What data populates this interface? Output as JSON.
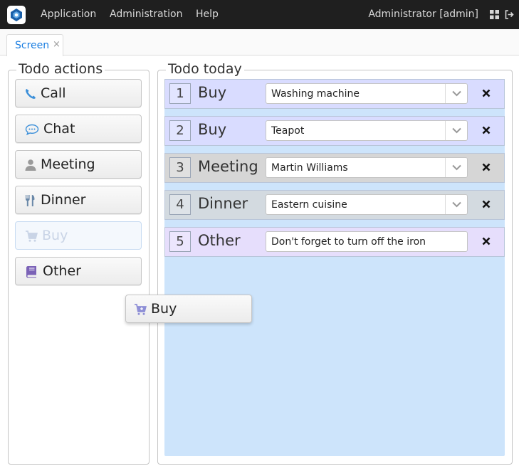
{
  "menubar": {
    "items": [
      "Application",
      "Administration",
      "Help"
    ],
    "user": "Administrator [admin]"
  },
  "tabs": [
    {
      "label": "Screen",
      "close": "×"
    }
  ],
  "todo_actions": {
    "title": "Todo actions",
    "buttons": [
      {
        "label": "Call",
        "icon": "phone-icon",
        "color": "#3b8fd9"
      },
      {
        "label": "Chat",
        "icon": "chat-bubble-icon",
        "color": "#3b8fd9"
      },
      {
        "label": "Meeting",
        "icon": "user-icon",
        "color": "#9a9a9a"
      },
      {
        "label": "Dinner",
        "icon": "cutlery-icon",
        "color": "#6a88a8"
      },
      {
        "label": "Buy",
        "icon": "cart-icon",
        "color": "#c9d4e6",
        "disabled": true
      },
      {
        "label": "Other",
        "icon": "book-icon",
        "color": "#7b62b7"
      }
    ]
  },
  "drag_ghost": {
    "label": "Buy",
    "icon": "cart-icon",
    "color": "#8e8fd6"
  },
  "todo_today": {
    "title": "Todo today",
    "rows": [
      {
        "num": "1",
        "type": "Buy",
        "value": "Washing machine",
        "kind": "combo",
        "bg": "#d9dcff"
      },
      {
        "num": "2",
        "type": "Buy",
        "value": "Teapot",
        "kind": "combo",
        "bg": "#d9dcff"
      },
      {
        "num": "3",
        "type": "Meeting",
        "value": "Martin Williams",
        "kind": "combo",
        "bg": "#d6d6d6"
      },
      {
        "num": "4",
        "type": "Dinner",
        "value": "Eastern cuisine",
        "kind": "combo",
        "bg": "#d3dae0"
      },
      {
        "num": "5",
        "type": "Other",
        "value": "Don't forget to turn off the iron",
        "kind": "text",
        "bg": "#e6defc"
      }
    ]
  }
}
